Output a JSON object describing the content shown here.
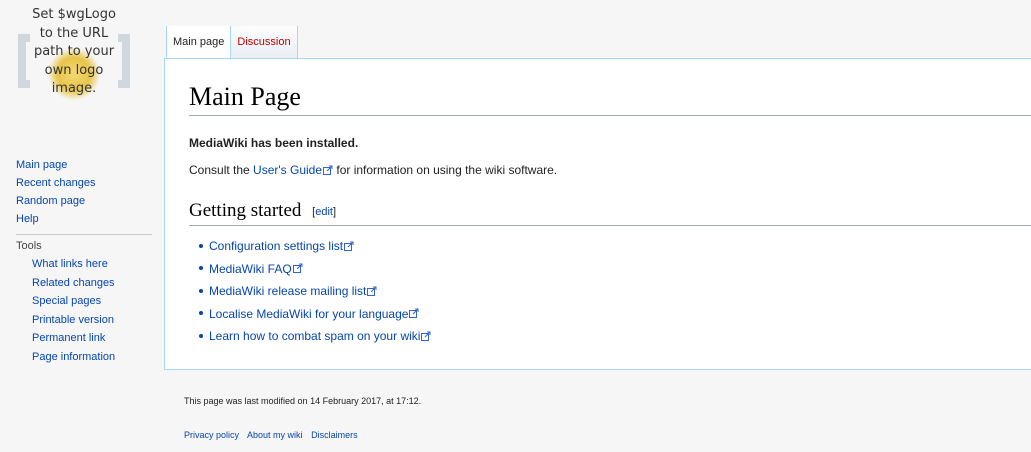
{
  "logo": {
    "lines": [
      "Set $wgLogo",
      "to the URL",
      "path to your",
      "own logo",
      "image."
    ]
  },
  "sidebar": {
    "navigation": [
      {
        "label": "Main page"
      },
      {
        "label": "Recent changes"
      },
      {
        "label": "Random page"
      },
      {
        "label": "Help"
      }
    ],
    "tools_heading": "Tools",
    "tools": [
      {
        "label": "What links here"
      },
      {
        "label": "Related changes"
      },
      {
        "label": "Special pages"
      },
      {
        "label": "Printable version"
      },
      {
        "label": "Permanent link"
      },
      {
        "label": "Page information"
      }
    ]
  },
  "tabs": [
    {
      "label": "Main page"
    },
    {
      "label": "Discussion"
    }
  ],
  "content": {
    "title": "Main Page",
    "installed": "MediaWiki has been installed.",
    "consult_before": "Consult the ",
    "users_guide_link": "User's Guide",
    "consult_after": " for information on using the wiki software.",
    "section_heading": "Getting started",
    "edit_open": "[",
    "edit_link": "edit",
    "edit_close": "]",
    "links": [
      {
        "label": "Configuration settings list"
      },
      {
        "label": "MediaWiki FAQ"
      },
      {
        "label": "MediaWiki release mailing list"
      },
      {
        "label": "Localise MediaWiki for your language"
      },
      {
        "label": "Learn how to combat spam on your wiki"
      }
    ]
  },
  "footer": {
    "last_modified": "This page was last modified on 14 February 2017, at 17:12.",
    "links": [
      {
        "label": "Privacy policy"
      },
      {
        "label": "About my wiki"
      },
      {
        "label": "Disclaimers"
      }
    ]
  },
  "colors": {
    "link": "#0645ad",
    "new_link": "#ba0000",
    "border": "#a7d7f9",
    "background": "#f6f6f6"
  }
}
